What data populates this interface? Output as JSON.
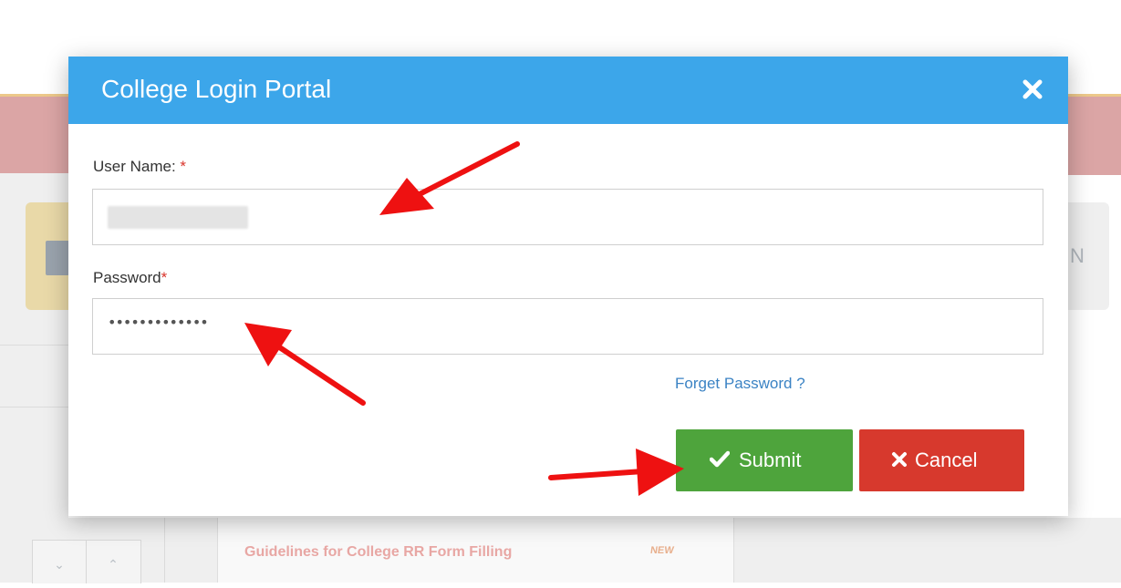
{
  "background": {
    "tile_letter": "N",
    "link_text": "Guidelines for College RR Form Filling",
    "new_badge": "NEW",
    "stepper_down": "⌄",
    "stepper_up": "⌃"
  },
  "modal": {
    "title": "College Login Portal",
    "close_glyph": "✕",
    "username": {
      "label": "User Name:",
      "required_mark": "*",
      "value": ""
    },
    "password": {
      "label": "Password",
      "required_mark": "*",
      "masked_value": "•••••••••••••"
    },
    "forgot_link": "Forget Password ?",
    "submit_label": "Submit",
    "cancel_label": "Cancel"
  },
  "colors": {
    "header": "#3ca6ea",
    "submit": "#4ea43c",
    "cancel": "#d7392d",
    "link": "#3b83c4",
    "annotation": "#ee1111"
  },
  "icons": {
    "close": "close-icon",
    "submit": "check-icon",
    "cancel": "x-icon"
  }
}
